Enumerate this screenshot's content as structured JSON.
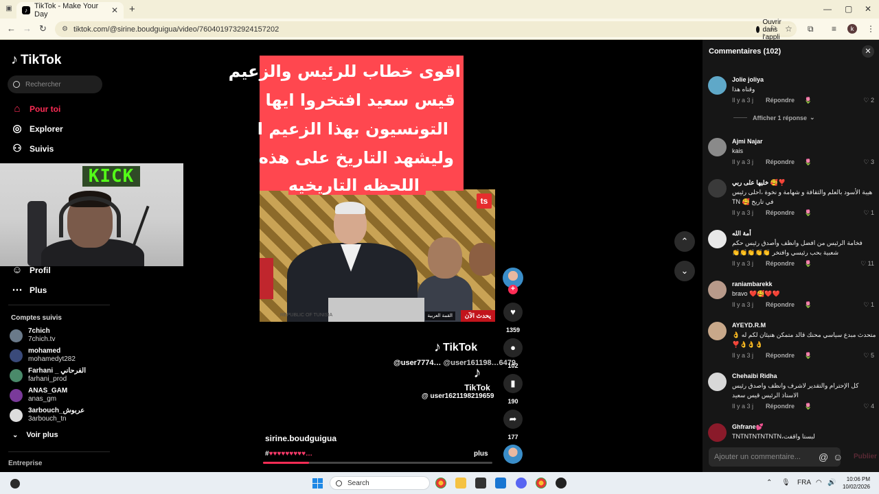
{
  "browser": {
    "tab_title": "TikTok - Make Your Day",
    "tab_favicon": "tiktok-icon",
    "new_tab": "+",
    "url": "tiktok.com/@sirine.boudguigua/video/7604019732924157202",
    "open_app_label": "Ouvrir dans l'appli"
  },
  "sidebar": {
    "logo": "TikTok",
    "search_placeholder": "Rechercher",
    "nav": [
      {
        "label": "Pour toi",
        "icon": "home-icon",
        "active": true
      },
      {
        "label": "Explorer",
        "icon": "compass-icon"
      },
      {
        "label": "Suivis",
        "icon": "users-icon"
      },
      {
        "label": "Profil",
        "icon": "profile-icon"
      },
      {
        "label": "Plus",
        "icon": "more-icon"
      }
    ],
    "followed_title": "Comptes suivis",
    "followed": [
      {
        "name": "7chich",
        "handle": "7chich.tv",
        "color": "#6a7a8a"
      },
      {
        "name": "mohamed",
        "handle": "mohamedyt282",
        "color": "#3a4a7a"
      },
      {
        "name": "Farhani _ الفرحاني",
        "handle": "farhani_prod",
        "color": "#4a8a6a"
      },
      {
        "name": "ANAS_GAM",
        "handle": "anas_gm",
        "color": "#7a3a9a"
      },
      {
        "name": "3arbouch_عربوش",
        "handle": "3arbouch_tn",
        "color": "#dddddd"
      }
    ],
    "see_more": "Voir plus",
    "company": "Entreprise"
  },
  "webcam": {
    "sign_text": "KICK"
  },
  "video": {
    "caption_lines": [
      "اقوى خطاب للرئيس والزعيم",
      "قيس سعيد افتخروا ايها",
      "التونسيون بهذا الزعيم ا",
      "وليشهد التاريخ على هذه",
      "اللحظه التاريخيه"
    ],
    "badge": "ts",
    "live_tag": "يحدث الآن",
    "summit_tag": "القمة العربية",
    "podium_text": "REPUBLIC OF TUNISIA",
    "watermark1_brand": "TikTok",
    "watermark1_user": "@user7774…",
    "watermark1_user_overlap": "@user161198…6479",
    "watermark2_brand": "TikTok",
    "watermark2_user": "@ user1621198219659",
    "author": "sirine.boudguigua",
    "hashtag_prefix": "#",
    "hashtags": "♥♥♥♥♥♥♥♥♥…",
    "more": "plus",
    "progress": 0.2
  },
  "actions": {
    "likes": "1359",
    "comments": "102",
    "saves": "190",
    "shares": "177"
  },
  "comments_panel": {
    "title": "Commentaires (102)",
    "show_replies": "Afficher 1 réponse",
    "reply_label": "Répondre",
    "input_placeholder": "Ajouter un commentaire...",
    "post_label": "Publier",
    "items": [
      {
        "name": "Jolie joliya",
        "text": "وقتاه هذا",
        "time": "Il y a 3 j",
        "likes": "2",
        "color": "#5fa8c8"
      },
      {
        "name": "Ajmi Najar",
        "text": "kais",
        "time": "Il y a 3 j",
        "likes": "3",
        "color": "#8a8a8a"
      },
      {
        "name": "خليها على ربي 🥰❣️",
        "text": "هيبة الأسود بالعلم والثقافة و شهامة و نخوة ،احلى رئيس في تاريخ 🥰 TN",
        "time": "Il y a 3 j",
        "likes": "1",
        "color": "#3a3a3a"
      },
      {
        "name": "أمة الله",
        "text": "فخامة الرئيس من افضل وانظف وأصدق رئيس حكم شعبية بحب رئيسي وافتخر 👏👏👏👏👏",
        "time": "Il y a 3 j",
        "likes": "11",
        "color": "#e8e8e8"
      },
      {
        "name": "raniambarekk",
        "text": "bravo ❤️🥰❤️❤️",
        "time": "Il y a 3 j",
        "likes": "1",
        "color": "#b89a8a"
      },
      {
        "name": "AYEYD.R.M",
        "text": "متحدث مبدع سياسي محنك قالد متمكن هنيئان لكم له 👌👌👌👌❣️",
        "time": "Il y a 3 j",
        "likes": "5",
        "color": "#c8a88a"
      },
      {
        "name": "Chehaibi Ridha",
        "text": "كل الإحترام والتقدير لاشرف وانظف واصدق رئيس الاستاذ الرئيس قيس سعيد",
        "time": "Il y a 3 j",
        "likes": "4",
        "color": "#d8d8d8"
      },
      {
        "name": "Ghfrane💕",
        "text": "لبستا واقفت،TNTNTNTNTNTN",
        "time": "",
        "likes": "",
        "color": "#8a1a2a"
      }
    ]
  },
  "taskbar": {
    "search": "Search",
    "lang": "FRA",
    "time": "10:06 PM",
    "date": "10/02/2026"
  }
}
